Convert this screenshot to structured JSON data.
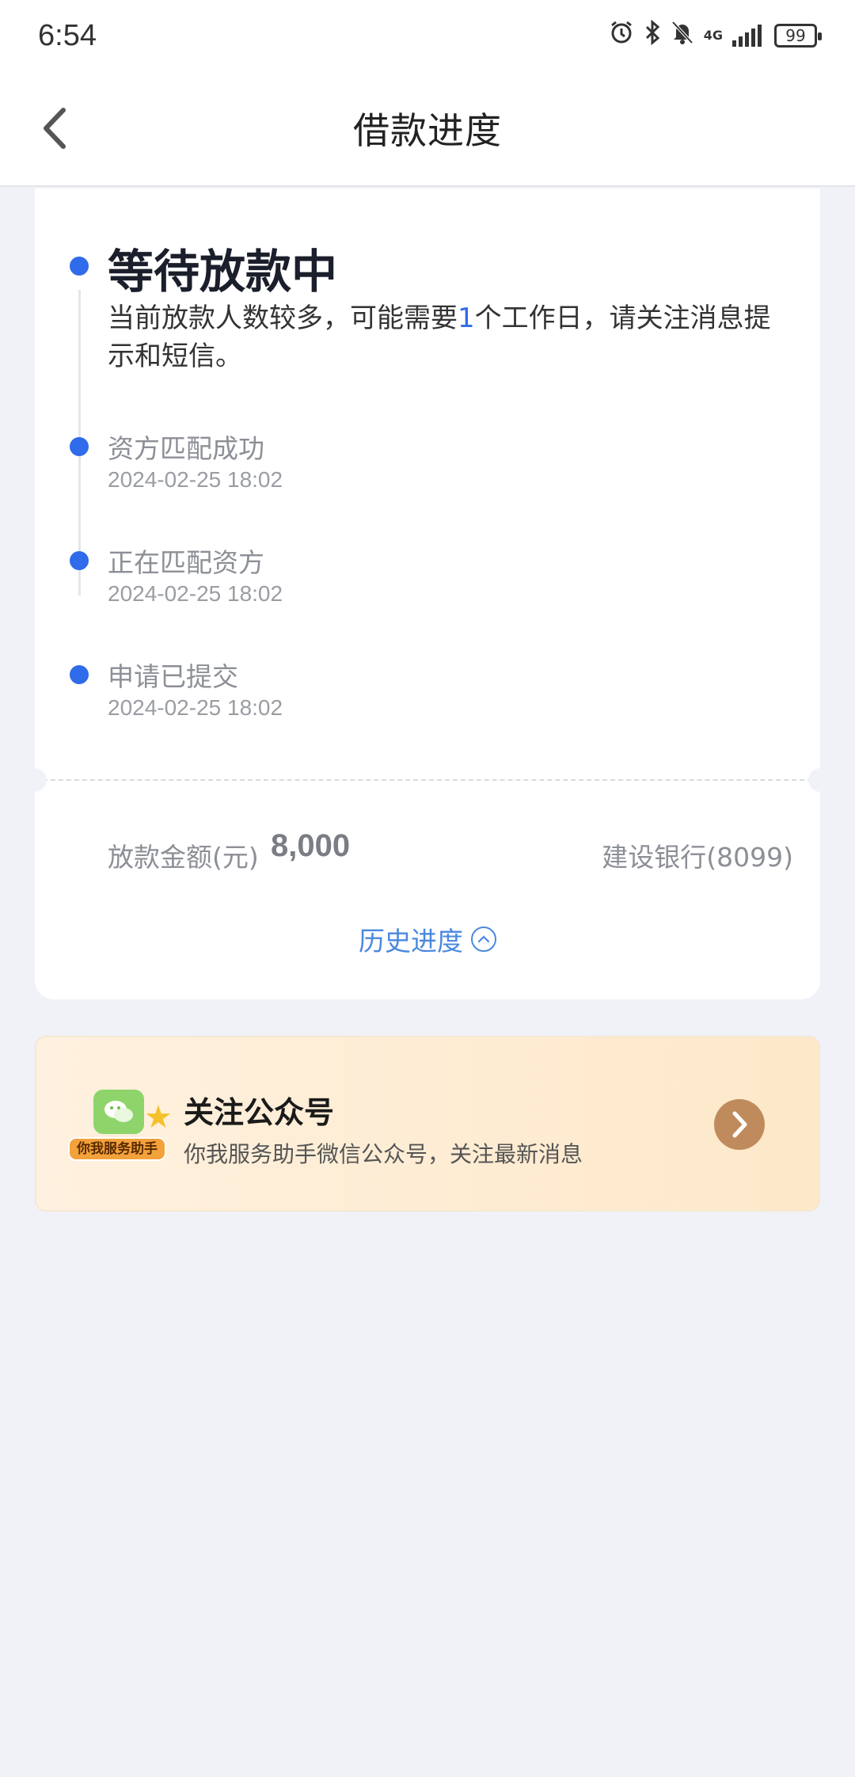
{
  "status_bar": {
    "time": "6:54",
    "network_label": "4G",
    "battery": "99"
  },
  "header": {
    "title": "借款进度",
    "back_icon": "chevron-left-icon"
  },
  "progress": {
    "current": {
      "title": "等待放款中",
      "desc_before": "当前放款人数较多，可能需要",
      "desc_highlight": "1",
      "desc_after": "个工作日，请关注消息提示和短信。"
    },
    "steps": [
      {
        "title": "资方匹配成功",
        "time": "2024-02-25 18:02"
      },
      {
        "title": "正在匹配资方",
        "time": "2024-02-25 18:02"
      },
      {
        "title": "申请已提交",
        "time": "2024-02-25 18:02"
      }
    ],
    "accent_color": "#2f6bea"
  },
  "loan": {
    "amount_label": "放款金额(元)",
    "amount_value": "8,000",
    "bank": "建设银行(8099)",
    "history_label": "历史进度"
  },
  "banner": {
    "badge_label": "你我服务助手",
    "title": "关注公众号",
    "subtitle": "你我服务助手微信公众号，关注最新消息",
    "arrow_icon": "chevron-right-icon"
  }
}
